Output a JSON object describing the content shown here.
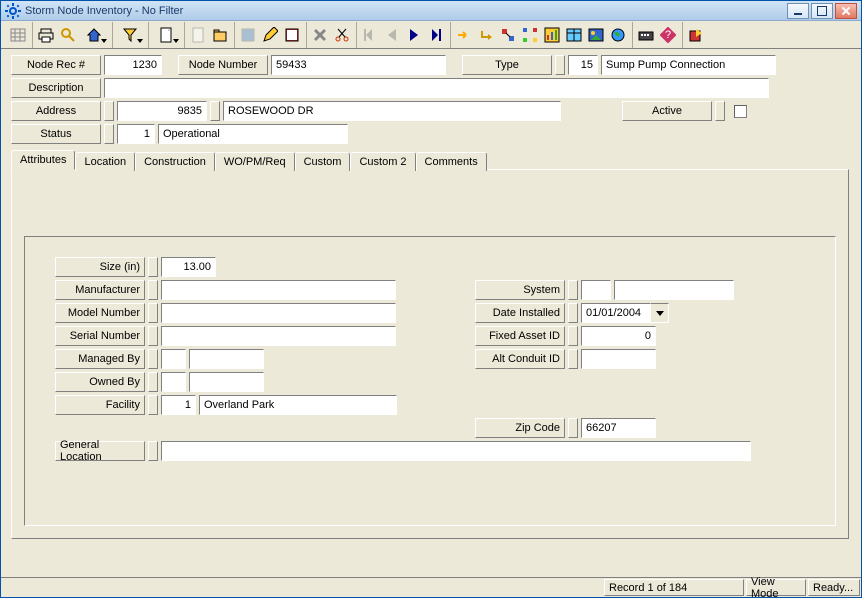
{
  "window": {
    "title": "Storm Node Inventory - No Filter"
  },
  "header": {
    "node_rec_label": "Node Rec #",
    "node_rec_value": "1230",
    "node_number_label": "Node Number",
    "node_number_value": "59433",
    "type_label": "Type",
    "type_code": "15",
    "type_desc": "Sump Pump Connection",
    "description_label": "Description",
    "description_value": "",
    "address_label": "Address",
    "address_num": "9835",
    "address_street": "ROSEWOOD DR",
    "active_label": "Active",
    "status_label": "Status",
    "status_code": "1",
    "status_desc": "Operational"
  },
  "tabs": [
    "Attributes",
    "Location",
    "Construction",
    "WO/PM/Req",
    "Custom",
    "Custom 2",
    "Comments"
  ],
  "attributes": {
    "size_label": "Size (in)",
    "size_value": "13.00",
    "manufacturer_label": "Manufacturer",
    "manufacturer_val": "",
    "model_label": "Model Number",
    "model_val": "",
    "serial_label": "Serial Number",
    "serial_val": "",
    "managed_label": "Managed By",
    "managed_code": "",
    "managed_val": "",
    "owned_label": "Owned By",
    "owned_code": "",
    "owned_val": "",
    "facility_label": "Facility",
    "facility_code": "1",
    "facility_val": "Overland Park",
    "general_loc_label": "General Location",
    "general_loc_val": "",
    "system_label": "System",
    "system_code": "",
    "system_val": "",
    "date_installed_label": "Date Installed",
    "date_installed_val": "01/01/2004",
    "fixed_asset_label": "Fixed Asset ID",
    "fixed_asset_val": "0",
    "alt_conduit_label": "Alt Conduit ID",
    "alt_conduit_val": "",
    "zip_label": "Zip Code",
    "zip_val": "66207"
  },
  "statusbar": {
    "record": "Record 1 of 184",
    "mode": "View Mode",
    "ready": "Ready..."
  }
}
